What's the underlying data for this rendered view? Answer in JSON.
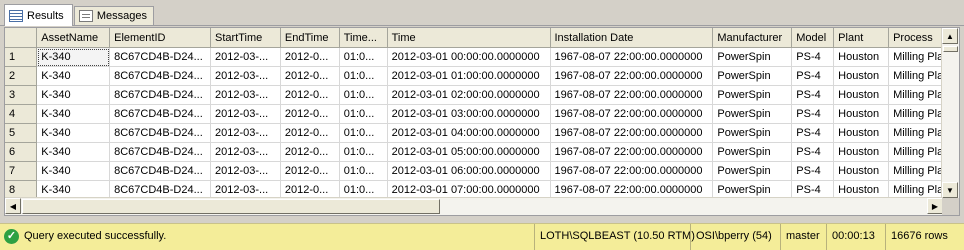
{
  "tabs": [
    {
      "label": "Results",
      "icon": "grid-icon"
    },
    {
      "label": "Messages",
      "icon": "messages-icon"
    }
  ],
  "grid": {
    "columns": [
      "AssetName",
      "ElementID",
      "StartTime",
      "EndTime",
      "Time...",
      "Time",
      "Installation Date",
      "Manufacturer",
      "Model",
      "Plant",
      "Process"
    ],
    "rows": [
      [
        "1",
        "K-340",
        "8C67CD4B-D24...",
        "2012-03-...",
        "2012-0...",
        "01:0...",
        "2012-03-01 00:00:00.0000000",
        "1967-08-07 22:00:00.0000000",
        "PowerSpin",
        "PS-4",
        "Houston",
        "Milling Pla"
      ],
      [
        "2",
        "K-340",
        "8C67CD4B-D24...",
        "2012-03-...",
        "2012-0...",
        "01:0...",
        "2012-03-01 01:00:00.0000000",
        "1967-08-07 22:00:00.0000000",
        "PowerSpin",
        "PS-4",
        "Houston",
        "Milling Pla"
      ],
      [
        "3",
        "K-340",
        "8C67CD4B-D24...",
        "2012-03-...",
        "2012-0...",
        "01:0...",
        "2012-03-01 02:00:00.0000000",
        "1967-08-07 22:00:00.0000000",
        "PowerSpin",
        "PS-4",
        "Houston",
        "Milling Pla"
      ],
      [
        "4",
        "K-340",
        "8C67CD4B-D24...",
        "2012-03-...",
        "2012-0...",
        "01:0...",
        "2012-03-01 03:00:00.0000000",
        "1967-08-07 22:00:00.0000000",
        "PowerSpin",
        "PS-4",
        "Houston",
        "Milling Pla"
      ],
      [
        "5",
        "K-340",
        "8C67CD4B-D24...",
        "2012-03-...",
        "2012-0...",
        "01:0...",
        "2012-03-01 04:00:00.0000000",
        "1967-08-07 22:00:00.0000000",
        "PowerSpin",
        "PS-4",
        "Houston",
        "Milling Pla"
      ],
      [
        "6",
        "K-340",
        "8C67CD4B-D24...",
        "2012-03-...",
        "2012-0...",
        "01:0...",
        "2012-03-01 05:00:00.0000000",
        "1967-08-07 22:00:00.0000000",
        "PowerSpin",
        "PS-4",
        "Houston",
        "Milling Pla"
      ],
      [
        "7",
        "K-340",
        "8C67CD4B-D24...",
        "2012-03-...",
        "2012-0...",
        "01:0...",
        "2012-03-01 06:00:00.0000000",
        "1967-08-07 22:00:00.0000000",
        "PowerSpin",
        "PS-4",
        "Houston",
        "Milling Pla"
      ],
      [
        "8",
        "K-340",
        "8C67CD4B-D24...",
        "2012-03-...",
        "2012-0...",
        "01:0...",
        "2012-03-01 07:00:00.0000000",
        "1967-08-07 22:00:00.0000000",
        "PowerSpin",
        "PS-4",
        "Houston",
        "Milling Pla"
      ]
    ]
  },
  "status": {
    "message": "Query executed successfully.",
    "server": "LOTH\\SQLBEAST (10.50 RTM)",
    "user": "OSI\\bperry (54)",
    "database": "master",
    "elapsed": "00:00:13",
    "rows": "16676 rows",
    "color": "#f4ed99"
  }
}
